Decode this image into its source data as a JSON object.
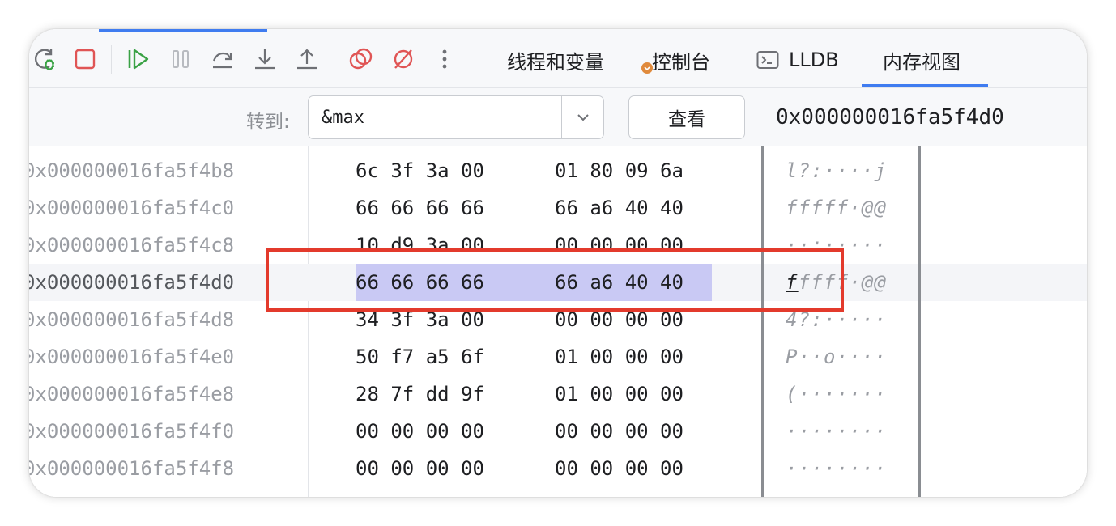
{
  "toolbar": {
    "icons": [
      "rerun-debug-icon",
      "stop-icon",
      "resume-icon",
      "pause-icon",
      "step-over-icon",
      "step-into-icon",
      "step-out-icon",
      "view-breakpoints-icon",
      "mute-breakpoints-icon",
      "more-icon"
    ],
    "colors": {
      "stop": "#e05555",
      "resume": "#3aa245",
      "gray": "#6e7075",
      "red": "#e05555"
    }
  },
  "tabs": [
    {
      "label": "线程和变量",
      "active": false
    },
    {
      "label": "控制台",
      "active": false,
      "badge_icon": "warning-badge-icon"
    },
    {
      "label": "LLDB",
      "active": false,
      "icon": "terminal-icon"
    },
    {
      "label": "内存视图",
      "active": true
    }
  ],
  "goto": {
    "label": "转到:",
    "value": "&max",
    "view_button": "查看",
    "current_address": "0x000000016fa5f4d0"
  },
  "memory": {
    "rows": [
      {
        "addr": "0x000000016fa5f4b8",
        "hex1": "6c 3f 3a 00",
        "hex2": "01 80 09 6a",
        "ascii": "l?:····j"
      },
      {
        "addr": "0x000000016fa5f4c0",
        "hex1": "66 66 66 66",
        "hex2": "66 a6 40 40",
        "ascii": "fffff·@@"
      },
      {
        "addr": "0x000000016fa5f4c8",
        "hex1": "10 d9 3a 00",
        "hex2": "00 00 00 00",
        "ascii": "··:·····"
      },
      {
        "addr": "0x000000016fa5f4d0",
        "hex1": "66 66 66 66",
        "hex2": "66 a6 40 40",
        "ascii_caret": "f",
        "ascii_rest": "ffff·@@",
        "current": true
      },
      {
        "addr": "0x000000016fa5f4d8",
        "hex1": "34 3f 3a 00",
        "hex2": "00 00 00 00",
        "ascii": "4?:·····"
      },
      {
        "addr": "0x000000016fa5f4e0",
        "hex1": "50 f7 a5 6f",
        "hex2": "01 00 00 00",
        "ascii": "P··o····"
      },
      {
        "addr": "0x000000016fa5f4e8",
        "hex1": "28 7f dd 9f",
        "hex2": "01 00 00 00",
        "ascii": "(·······"
      },
      {
        "addr": "0x000000016fa5f4f0",
        "hex1": "00 00 00 00",
        "hex2": "00 00 00 00",
        "ascii": "········"
      },
      {
        "addr": "0x000000016fa5f4f8",
        "hex1": "00 00 00 00",
        "hex2": "00 00 00 00",
        "ascii": "········"
      }
    ],
    "selection_color": "#c9c9f4",
    "highlight_color": "#e33a2c"
  }
}
